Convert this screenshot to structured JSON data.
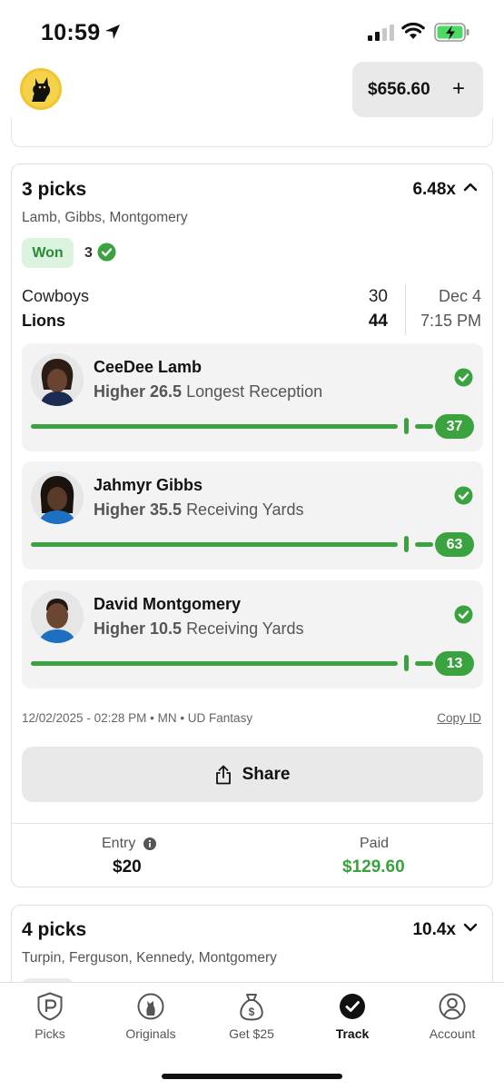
{
  "status_bar": {
    "time": "10:59"
  },
  "header": {
    "balance": "$656.60",
    "add_symbol": "+"
  },
  "entry_card": {
    "title": "3 picks",
    "multiplier": "6.48x",
    "players": "Lamb, Gibbs, Montgomery",
    "status": "Won",
    "correct_count": "3",
    "game": {
      "team1": "Cowboys",
      "score1": "30",
      "team2": "Lions",
      "score2": "44",
      "date": "Dec 4",
      "time": "7:15 PM"
    },
    "picks": [
      {
        "name": "CeeDee Lamb",
        "direction": "Higher 26.5",
        "stat": "Longest Reception",
        "result": "37",
        "progress": 1.0
      },
      {
        "name": "Jahmyr Gibbs",
        "direction": "Higher 35.5",
        "stat": "Receiving Yards",
        "result": "63",
        "progress": 1.0
      },
      {
        "name": "David Montgomery",
        "direction": "Higher 10.5",
        "stat": "Receiving Yards",
        "result": "13",
        "progress": 1.0
      }
    ],
    "meta": "12/02/2025 - 02:28 PM • MN • UD Fantasy",
    "copy_id": "Copy ID",
    "share_label": "Share",
    "entry_label": "Entry",
    "entry_value": "$20",
    "paid_label": "Paid",
    "paid_value": "$129.60"
  },
  "next_card": {
    "title": "4 picks",
    "multiplier": "10.4x",
    "players": "Turpin, Ferguson, Kennedy, Montgomery"
  },
  "tabs": [
    {
      "label": "Picks",
      "icon": "picks-icon"
    },
    {
      "label": "Originals",
      "icon": "originals-icon"
    },
    {
      "label": "Get $25",
      "icon": "money-bag-icon"
    },
    {
      "label": "Track",
      "icon": "check-circle-icon",
      "active": true
    },
    {
      "label": "Account",
      "icon": "account-icon"
    }
  ],
  "colors": {
    "success": "#3aa23f",
    "won_bg": "#dcf3e0",
    "button_bg": "#e9e9ea",
    "logo": "#f4d24a"
  }
}
